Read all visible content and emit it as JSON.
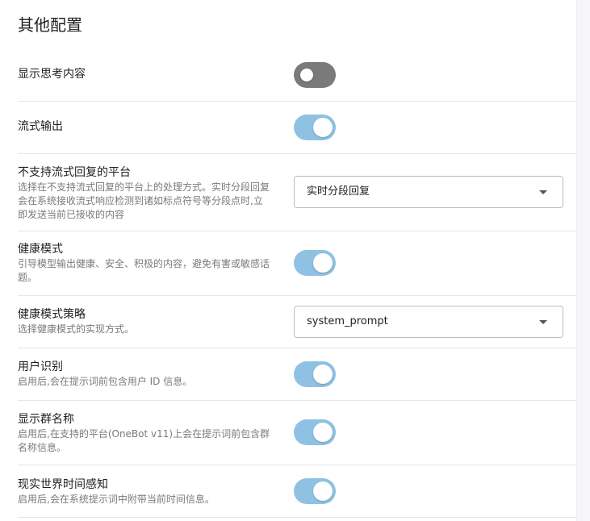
{
  "section": {
    "title": "其他配置"
  },
  "settings": {
    "show_thinking": {
      "title": "显示思考内容",
      "state": "off"
    },
    "stream_output": {
      "title": "流式输出",
      "state": "on"
    },
    "unsupported_stream": {
      "title": "不支持流式回复的平台",
      "desc_lines": [
        "选择在不支持流式回复的平台上的处理方式。实时分段回复",
        "会在系统接收流式响应检测到诸如标点符号等分段点时,立",
        "即发送当前已接收的内容"
      ],
      "selected": "实时分段回复"
    },
    "health_mode": {
      "title": "健康模式",
      "desc_lines": [
        "引导模型输出健康、安全、积极的内容，避免有害或敏感话",
        "题。"
      ],
      "state": "on"
    },
    "health_strategy": {
      "title": "健康模式策略",
      "desc_lines": [
        "选择健康模式的实现方式。"
      ],
      "selected": "system_prompt"
    },
    "user_identify": {
      "title": "用户识别",
      "desc_lines": [
        "启用后,会在提示词前包含用户 ID 信息。"
      ],
      "state": "on"
    },
    "show_group_name": {
      "title": "显示群名称",
      "desc_lines": [
        "启用后,在支持的平台(OneBot v11)上会在提示词前包含群",
        "名称信息。"
      ],
      "state": "on"
    },
    "realtime_awareness": {
      "title": "现实世界时间感知",
      "desc_lines": [
        "启用后,会在系统提示词中附带当前时间信息。"
      ],
      "state": "on"
    }
  },
  "colors": {
    "toggle_on": "#8fc1e2",
    "toggle_off": "#7a7a7a",
    "divider": "#e6e6e6"
  }
}
